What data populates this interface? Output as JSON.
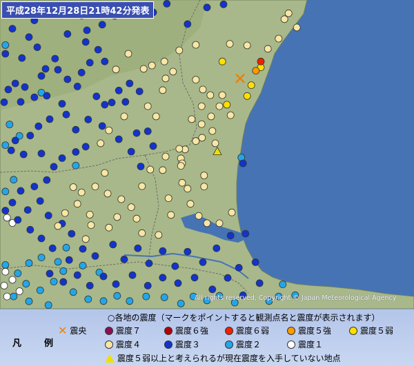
{
  "map": {
    "title": "平成28年12月28日21時42分発表",
    "copyright": "All rights reserved, Copyright © Japan Meteorological Agency"
  },
  "colors": {
    "sea": "#3f6fb0",
    "land": "#a9b98a",
    "int1": "#ffffff",
    "int2": "#23a6e8",
    "int3": "#1234cc",
    "int4": "#f7e6a4",
    "int5lower": "#ffe000",
    "int5upper": "#ff9a00",
    "int6lower": "#ee2200",
    "int6upper": "#b80000",
    "int7": "#8b0f53"
  },
  "legend": {
    "title": "凡　例",
    "note": "○各地の震度（マークをポイントすると観測点名と震度が表示されます）",
    "items": [
      {
        "key": "epicenter",
        "label": "震央"
      },
      {
        "key": "int7",
        "label": "震度７"
      },
      {
        "key": "int6upper",
        "label": "震度６強"
      },
      {
        "key": "int6lower",
        "label": "震度６弱"
      },
      {
        "key": "int5upper",
        "label": "震度５強"
      },
      {
        "key": "int5lower",
        "label": "震度５弱"
      },
      {
        "key": "int4",
        "label": "震度４"
      },
      {
        "key": "int3",
        "label": "震度３"
      },
      {
        "key": "int2",
        "label": "震度２"
      },
      {
        "key": "int1",
        "label": "震度１"
      },
      {
        "key": "unknown",
        "label": "震度５弱以上と考えられるが現在震度を入手していない地点"
      }
    ]
  },
  "stations": {
    "int6lower": [
      [
        0.63,
        0.199
      ]
    ],
    "int5upper": [
      [
        0.618,
        0.229
      ]
    ],
    "int5lower": [
      [
        0.537,
        0.199
      ],
      [
        0.63,
        0.218
      ],
      [
        0.607,
        0.276
      ],
      [
        0.597,
        0.311
      ],
      [
        0.548,
        0.339
      ]
    ],
    "int4": [
      [
        0.697,
        0.043
      ],
      [
        0.687,
        0.062
      ],
      [
        0.717,
        0.089
      ],
      [
        0.673,
        0.125
      ],
      [
        0.647,
        0.158
      ],
      [
        0.597,
        0.147
      ],
      [
        0.555,
        0.142
      ],
      [
        0.473,
        0.145
      ],
      [
        0.433,
        0.163
      ],
      [
        0.397,
        0.199
      ],
      [
        0.367,
        0.212
      ],
      [
        0.4,
        0.254
      ],
      [
        0.418,
        0.232
      ],
      [
        0.393,
        0.292
      ],
      [
        0.473,
        0.258
      ],
      [
        0.49,
        0.29
      ],
      [
        0.508,
        0.308
      ],
      [
        0.537,
        0.308
      ],
      [
        0.53,
        0.344
      ],
      [
        0.557,
        0.373
      ],
      [
        0.51,
        0.377
      ],
      [
        0.487,
        0.344
      ],
      [
        0.463,
        0.386
      ],
      [
        0.487,
        0.402
      ],
      [
        0.513,
        0.424
      ],
      [
        0.488,
        0.446
      ],
      [
        0.52,
        0.464
      ],
      [
        0.473,
        0.457
      ],
      [
        0.447,
        0.484
      ],
      [
        0.433,
        0.482
      ],
      [
        0.437,
        0.513
      ],
      [
        0.357,
        0.344
      ],
      [
        0.377,
        0.377
      ],
      [
        0.3,
        0.377
      ],
      [
        0.263,
        0.422
      ],
      [
        0.243,
        0.464
      ],
      [
        0.253,
        0.56
      ],
      [
        0.23,
        0.604
      ],
      [
        0.26,
        0.627
      ],
      [
        0.293,
        0.645
      ],
      [
        0.317,
        0.671
      ],
      [
        0.283,
        0.703
      ],
      [
        0.217,
        0.695
      ],
      [
        0.22,
        0.729
      ],
      [
        0.207,
        0.774
      ],
      [
        0.263,
        0.737
      ],
      [
        0.33,
        0.708
      ],
      [
        0.343,
        0.755
      ],
      [
        0.383,
        0.761
      ],
      [
        0.413,
        0.696
      ],
      [
        0.407,
        0.642
      ],
      [
        0.44,
        0.592
      ],
      [
        0.453,
        0.611
      ],
      [
        0.493,
        0.604
      ],
      [
        0.493,
        0.568
      ],
      [
        0.44,
        0.529
      ],
      [
        0.4,
        0.507
      ],
      [
        0.363,
        0.549
      ],
      [
        0.343,
        0.603
      ],
      [
        0.393,
        0.551
      ],
      [
        0.46,
        0.66
      ],
      [
        0.48,
        0.699
      ],
      [
        0.5,
        0.723
      ],
      [
        0.53,
        0.723
      ],
      [
        0.56,
        0.688
      ],
      [
        0.187,
        0.66
      ],
      [
        0.157,
        0.69
      ],
      [
        0.14,
        0.732
      ],
      [
        0.197,
        0.623
      ],
      [
        0.177,
        0.606
      ],
      [
        0.28,
        0.225
      ],
      [
        0.347,
        0.223
      ],
      [
        0.31,
        0.174
      ],
      [
        0.437,
        0.537
      ]
    ],
    "int3": [
      [
        0.403,
        0.012
      ],
      [
        0.37,
        0.04
      ],
      [
        0.32,
        0.038
      ],
      [
        0.277,
        0.051
      ],
      [
        0.247,
        0.08
      ],
      [
        0.21,
        0.098
      ],
      [
        0.163,
        0.11
      ],
      [
        0.207,
        0.136
      ],
      [
        0.237,
        0.161
      ],
      [
        0.253,
        0.199
      ],
      [
        0.217,
        0.203
      ],
      [
        0.197,
        0.235
      ],
      [
        0.14,
        0.226
      ],
      [
        0.11,
        0.223
      ],
      [
        0.1,
        0.246
      ],
      [
        0.06,
        0.282
      ],
      [
        0.037,
        0.27
      ],
      [
        0.02,
        0.29
      ],
      [
        0.01,
        0.331
      ],
      [
        0.05,
        0.33
      ],
      [
        0.083,
        0.315
      ],
      [
        0.113,
        0.31
      ],
      [
        0.15,
        0.336
      ],
      [
        0.16,
        0.371
      ],
      [
        0.12,
        0.386
      ],
      [
        0.093,
        0.409
      ],
      [
        0.073,
        0.439
      ],
      [
        0.037,
        0.455
      ],
      [
        0.027,
        0.487
      ],
      [
        0.057,
        0.5
      ],
      [
        0.1,
        0.497
      ],
      [
        0.13,
        0.54
      ],
      [
        0.15,
        0.512
      ],
      [
        0.183,
        0.492
      ],
      [
        0.207,
        0.475
      ],
      [
        0.183,
        0.42
      ],
      [
        0.213,
        0.387
      ],
      [
        0.253,
        0.339
      ],
      [
        0.303,
        0.33
      ],
      [
        0.337,
        0.296
      ],
      [
        0.313,
        0.27
      ],
      [
        0.287,
        0.293
      ],
      [
        0.27,
        0.332
      ],
      [
        0.233,
        0.312
      ],
      [
        0.187,
        0.28
      ],
      [
        0.163,
        0.257
      ],
      [
        0.133,
        0.19
      ],
      [
        0.09,
        0.153
      ],
      [
        0.07,
        0.12
      ],
      [
        0.03,
        0.093
      ],
      [
        0.083,
        0.066
      ],
      [
        0.123,
        0.04
      ],
      [
        0.163,
        0.03
      ],
      [
        0.197,
        0.05
      ],
      [
        0.053,
        0.188
      ],
      [
        0.013,
        0.174
      ],
      [
        0.247,
        0.408
      ],
      [
        0.287,
        0.451
      ],
      [
        0.317,
        0.491
      ],
      [
        0.34,
        0.539
      ],
      [
        0.357,
        0.425
      ],
      [
        0.37,
        0.473
      ],
      [
        0.33,
        0.431
      ],
      [
        0.113,
        0.583
      ],
      [
        0.083,
        0.604
      ],
      [
        0.05,
        0.618
      ],
      [
        0.03,
        0.656
      ],
      [
        0.067,
        0.68
      ],
      [
        0.097,
        0.651
      ],
      [
        0.117,
        0.698
      ],
      [
        0.15,
        0.724
      ],
      [
        0.173,
        0.757
      ],
      [
        0.2,
        0.806
      ],
      [
        0.23,
        0.829
      ],
      [
        0.167,
        0.842
      ],
      [
        0.127,
        0.804
      ],
      [
        0.1,
        0.772
      ],
      [
        0.073,
        0.744
      ],
      [
        0.043,
        0.712
      ],
      [
        0.013,
        0.682
      ],
      [
        0.273,
        0.792
      ],
      [
        0.3,
        0.84
      ],
      [
        0.333,
        0.804
      ],
      [
        0.36,
        0.853
      ],
      [
        0.393,
        0.813
      ],
      [
        0.423,
        0.862
      ],
      [
        0.453,
        0.815
      ],
      [
        0.49,
        0.849
      ],
      [
        0.523,
        0.804
      ],
      [
        0.557,
        0.763
      ],
      [
        0.593,
        0.757
      ],
      [
        0.577,
        0.867
      ],
      [
        0.55,
        0.9
      ],
      [
        0.617,
        0.849
      ],
      [
        0.627,
        0.917
      ],
      [
        0.587,
        0.956
      ],
      [
        0.513,
        0.937
      ],
      [
        0.47,
        0.899
      ],
      [
        0.43,
        0.917
      ],
      [
        0.393,
        0.899
      ],
      [
        0.357,
        0.925
      ],
      [
        0.32,
        0.891
      ],
      [
        0.28,
        0.92
      ],
      [
        0.25,
        0.895
      ],
      [
        0.217,
        0.925
      ],
      [
        0.187,
        0.891
      ],
      [
        0.153,
        0.913
      ],
      [
        0.12,
        0.886
      ],
      [
        0.587,
        0.529
      ],
      [
        0.5,
        0.024
      ],
      [
        0.54,
        0.014
      ],
      [
        0.453,
        0.078
      ]
    ],
    "int2": [
      [
        0.013,
        0.023
      ],
      [
        0.05,
        0.033
      ],
      [
        0.093,
        0.018
      ],
      [
        0.013,
        0.146
      ],
      [
        0.1,
        0.3
      ],
      [
        0.023,
        0.403
      ],
      [
        0.047,
        0.44
      ],
      [
        0.013,
        0.47
      ],
      [
        0.183,
        0.536
      ],
      [
        0.033,
        0.582
      ],
      [
        0.013,
        0.62
      ],
      [
        0.16,
        0.802
      ],
      [
        0.14,
        0.848
      ],
      [
        0.13,
        0.912
      ],
      [
        0.097,
        0.94
      ],
      [
        0.063,
        0.919
      ],
      [
        0.043,
        0.885
      ],
      [
        0.013,
        0.858
      ],
      [
        0.07,
        0.852
      ],
      [
        0.1,
        0.834
      ],
      [
        0.153,
        0.878
      ],
      [
        0.177,
        0.946
      ],
      [
        0.213,
        0.969
      ],
      [
        0.25,
        0.975
      ],
      [
        0.283,
        0.958
      ],
      [
        0.313,
        0.975
      ],
      [
        0.353,
        0.96
      ],
      [
        0.397,
        0.963
      ],
      [
        0.437,
        0.983
      ],
      [
        0.467,
        0.96
      ],
      [
        0.5,
        0.973
      ],
      [
        0.53,
        0.958
      ],
      [
        0.567,
        0.98
      ],
      [
        0.65,
        0.975
      ],
      [
        0.683,
        0.921
      ],
      [
        0.673,
        0.96
      ],
      [
        0.713,
        0.956
      ],
      [
        0.033,
        0.96
      ],
      [
        0.07,
        0.976
      ],
      [
        0.117,
        0.988
      ],
      [
        0.2,
        0.86
      ],
      [
        0.24,
        0.882
      ],
      [
        0.583,
        0.51
      ]
    ],
    "int1": [
      [
        0.017,
        0.705
      ],
      [
        0.03,
        0.722
      ],
      [
        0.013,
        0.88
      ],
      [
        0.03,
        0.906
      ],
      [
        0.01,
        0.925
      ],
      [
        0.047,
        0.943
      ],
      [
        0.017,
        0.96
      ]
    ],
    "epicenter": [
      [
        0.58,
        0.254
      ]
    ],
    "unknown": [
      [
        0.525,
        0.49
      ]
    ]
  }
}
